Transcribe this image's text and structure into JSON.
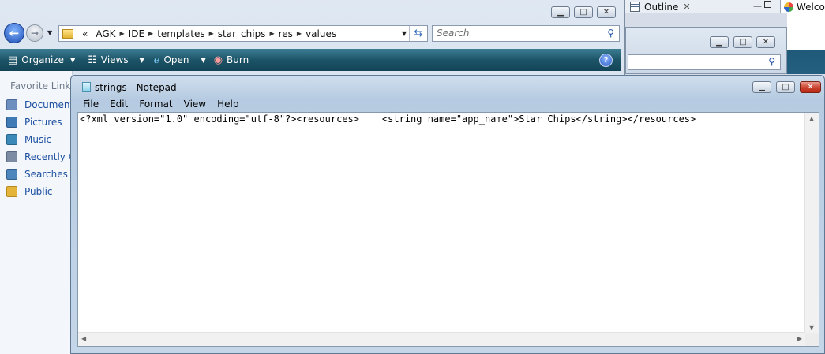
{
  "explorer": {
    "address_parts": [
      "«",
      "AGK",
      "IDE",
      "templates",
      "star_chips",
      "res",
      "values"
    ],
    "search_placeholder": "Search",
    "toolbar": {
      "organize": "Organize",
      "views": "Views",
      "open": "Open",
      "burn": "Burn"
    },
    "favorites_title": "Favorite Links",
    "favorites": [
      {
        "label": "Documents",
        "icon": "documents-icon",
        "color": "#6c8fc0"
      },
      {
        "label": "Pictures",
        "icon": "pictures-icon",
        "color": "#3f7bb6"
      },
      {
        "label": "Music",
        "icon": "music-icon",
        "color": "#3a89b8"
      },
      {
        "label": "Recently C",
        "icon": "recent-icon",
        "color": "#7d8ca3"
      },
      {
        "label": "Searches",
        "icon": "searches-icon",
        "color": "#4c86bd"
      },
      {
        "label": "Public",
        "icon": "public-folder-icon",
        "color": "#e5b43a"
      }
    ]
  },
  "ide": {
    "outline_tab": "Outline",
    "welcome_tab": "Welco"
  },
  "notepad": {
    "title": "strings - Notepad",
    "menu": [
      "File",
      "Edit",
      "Format",
      "View",
      "Help"
    ],
    "content": "<?xml version=\"1.0\" encoding=\"utf-8\"?><resources>    <string name=\"app_name\">Star Chips</string></resources>"
  }
}
